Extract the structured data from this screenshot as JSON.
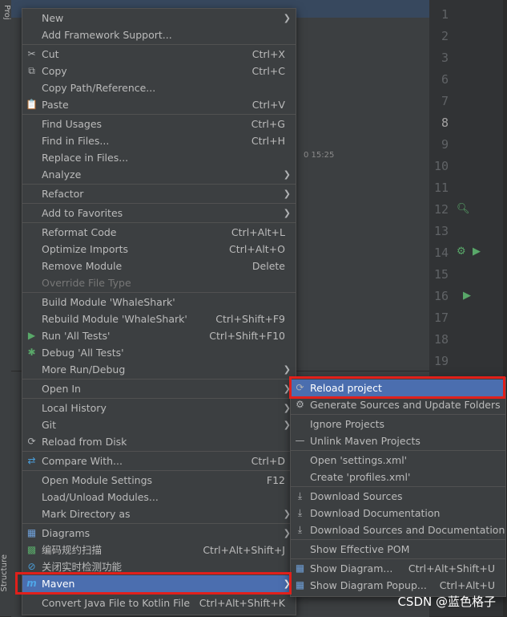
{
  "background": {
    "project_tab": "Proj",
    "structure_tab": "Structure",
    "timestamp_fragment": "0 15:25",
    "line_numbers": [
      "1",
      "2",
      "3",
      "6",
      "7",
      "8",
      "9",
      "10",
      "11",
      "12",
      "13",
      "14",
      "15",
      "16",
      "17",
      "18",
      "19"
    ]
  },
  "main_menu": {
    "items": [
      {
        "label": "New",
        "submenu": true
      },
      {
        "label": "Add Framework Support..."
      },
      {
        "sep": true
      },
      {
        "label": "Cut",
        "shortcut": "Ctrl+X",
        "icon": "scissors-icon",
        "glyph": "✂"
      },
      {
        "label": "Copy",
        "shortcut": "Ctrl+C",
        "icon": "copy-icon",
        "glyph": "⧉"
      },
      {
        "label": "Copy Path/Reference..."
      },
      {
        "label": "Paste",
        "shortcut": "Ctrl+V",
        "icon": "clipboard-icon",
        "glyph": "📋"
      },
      {
        "sep": true
      },
      {
        "label": "Find Usages",
        "shortcut": "Ctrl+G"
      },
      {
        "label": "Find in Files...",
        "shortcut": "Ctrl+H"
      },
      {
        "label": "Replace in Files..."
      },
      {
        "label": "Analyze",
        "submenu": true
      },
      {
        "sep": true
      },
      {
        "label": "Refactor",
        "submenu": true
      },
      {
        "sep": true
      },
      {
        "label": "Add to Favorites",
        "submenu": true
      },
      {
        "sep": true
      },
      {
        "label": "Reformat Code",
        "shortcut": "Ctrl+Alt+L"
      },
      {
        "label": "Optimize Imports",
        "shortcut": "Ctrl+Alt+O"
      },
      {
        "label": "Remove Module",
        "shortcut": "Delete"
      },
      {
        "label": "Override File Type",
        "disabled": true
      },
      {
        "sep": true
      },
      {
        "label": "Build Module 'WhaleShark'"
      },
      {
        "label": "Rebuild Module 'WhaleShark'",
        "shortcut": "Ctrl+Shift+F9"
      },
      {
        "label": "Run 'All Tests'",
        "shortcut": "Ctrl+Shift+F10",
        "icon": "run-icon",
        "glyph": "▶",
        "color": "#59a869"
      },
      {
        "label": "Debug 'All Tests'",
        "icon": "debug-icon",
        "glyph": "✱",
        "color": "#59a869"
      },
      {
        "label": "More Run/Debug",
        "submenu": true
      },
      {
        "sep": true
      },
      {
        "label": "Open In",
        "submenu": true
      },
      {
        "sep": true
      },
      {
        "label": "Local History",
        "submenu": true
      },
      {
        "label": "Git",
        "submenu": true
      },
      {
        "label": "Reload from Disk",
        "icon": "reload-icon",
        "glyph": "⟳"
      },
      {
        "sep": true
      },
      {
        "label": "Compare With...",
        "shortcut": "Ctrl+D",
        "icon": "compare-icon",
        "glyph": "⇄",
        "color": "#4a9eda"
      },
      {
        "sep": true
      },
      {
        "label": "Open Module Settings",
        "shortcut": "F12"
      },
      {
        "label": "Load/Unload Modules..."
      },
      {
        "label": "Mark Directory as",
        "submenu": true
      },
      {
        "sep": true
      },
      {
        "label": "Diagrams",
        "submenu": true,
        "icon": "diagram-icon",
        "glyph": "▦",
        "color": "#6e9fd8"
      },
      {
        "label": "编码规约扫描",
        "shortcut": "Ctrl+Alt+Shift+J",
        "icon": "scan-icon",
        "glyph": "▩",
        "color": "#59a869"
      },
      {
        "label": "关闭实时检测功能",
        "icon": "disable-icon",
        "glyph": "⊘",
        "color": "#4a9eda"
      },
      {
        "label": "Maven",
        "submenu": true,
        "selected": true,
        "icon": "maven-icon",
        "glyph": "m",
        "color": "#4fa6e8"
      },
      {
        "sep": true
      },
      {
        "label": "Convert Java File to Kotlin File",
        "shortcut": "Ctrl+Alt+Shift+K"
      }
    ]
  },
  "maven_menu": {
    "items": [
      {
        "label": "Reload project",
        "selected": true,
        "icon": "reload-icon",
        "glyph": "⟳"
      },
      {
        "label": "Generate Sources and Update Folders",
        "icon": "generate-icon",
        "glyph": "⚙"
      },
      {
        "sep": true
      },
      {
        "label": "Ignore Projects"
      },
      {
        "label": "Unlink Maven Projects",
        "icon": "minus-icon",
        "glyph": "—"
      },
      {
        "sep": true
      },
      {
        "label": "Open 'settings.xml'"
      },
      {
        "label": "Create 'profiles.xml'"
      },
      {
        "sep": true
      },
      {
        "label": "Download Sources",
        "icon": "download-icon",
        "glyph": "⤓"
      },
      {
        "label": "Download Documentation",
        "icon": "download-icon",
        "glyph": "⤓"
      },
      {
        "label": "Download Sources and Documentation",
        "icon": "download-icon",
        "glyph": "⤓"
      },
      {
        "sep": true
      },
      {
        "label": "Show Effective POM"
      },
      {
        "sep": true
      },
      {
        "label": "Show Diagram...",
        "shortcut": "Ctrl+Alt+Shift+U",
        "icon": "diagram-icon",
        "glyph": "▦",
        "color": "#6e9fd8"
      },
      {
        "label": "Show Diagram Popup...",
        "shortcut": "Ctrl+Alt+U",
        "icon": "diagram-icon",
        "glyph": "▦",
        "color": "#6e9fd8"
      }
    ]
  },
  "watermark": "CSDN @蓝色格子"
}
